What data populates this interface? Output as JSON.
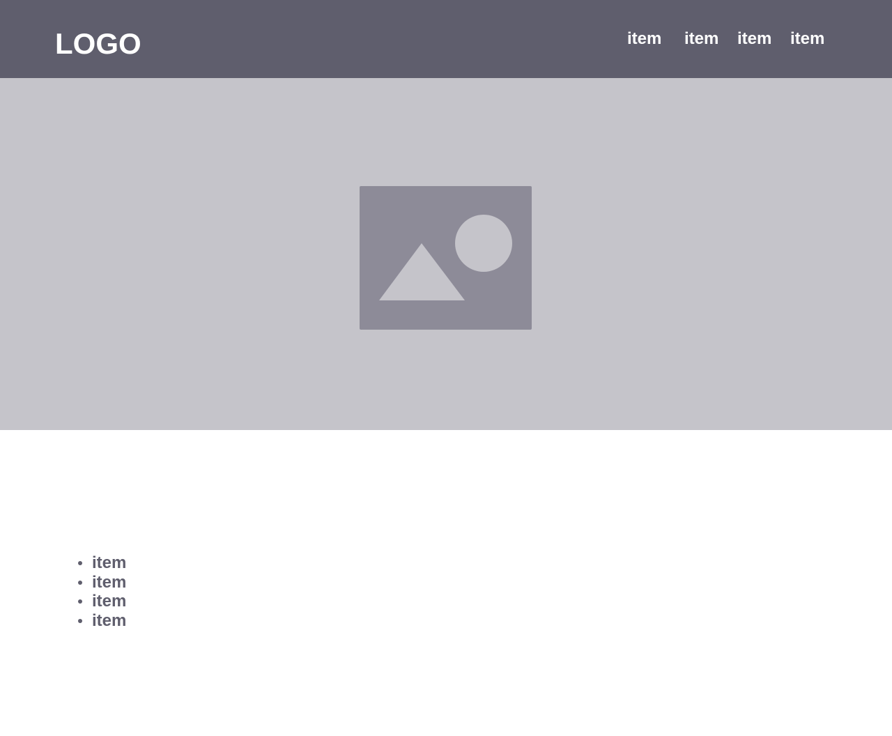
{
  "header": {
    "logo": "LOGO",
    "nav": [
      "item",
      "item",
      "item",
      "item"
    ]
  },
  "hero": {
    "image": "image-placeholder-icon"
  },
  "content": {
    "list": [
      "item",
      "item",
      "item",
      "item"
    ]
  },
  "colors": {
    "header_bg": "#5f5e6d",
    "hero_bg": "#c5c4ca",
    "placeholder": "#8d8b98",
    "list_text": "#5f5e6d"
  }
}
